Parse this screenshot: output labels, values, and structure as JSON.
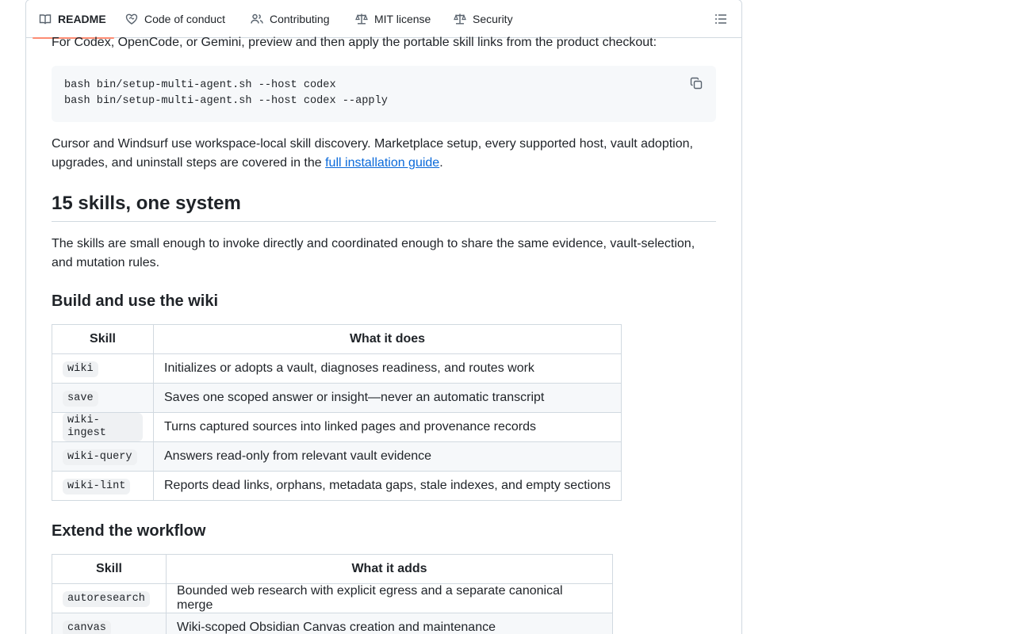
{
  "tabs": [
    {
      "label": "README",
      "icon": "book-icon",
      "active": true
    },
    {
      "label": "Code of conduct",
      "icon": "heart-handshake-icon"
    },
    {
      "label": "Contributing",
      "icon": "people-icon"
    },
    {
      "label": "MIT license",
      "icon": "scale-icon"
    },
    {
      "label": "Security",
      "icon": "scale-icon"
    }
  ],
  "accent_color": "#fd8c73",
  "link_color": "#0969da",
  "intro": "For Codex, OpenCode, or Gemini, preview and then apply the portable skill links from the product checkout:",
  "code_lines": [
    "bash bin/setup-multi-agent.sh --host codex",
    "bash bin/setup-multi-agent.sh --host codex --apply"
  ],
  "install_para": {
    "before": "Cursor and Windsurf use workspace-local skill discovery. Marketplace setup, every supported host, vault adoption, upgrades, and uninstall steps are covered in the ",
    "link": "full installation guide",
    "after": "."
  },
  "section_heading": "15 skills, one system",
  "section_para": "The skills are small enough to invoke directly and coordinated enough to share the same evidence, vault-selection, and mutation rules.",
  "build_heading": "Build and use the wiki",
  "build_table": {
    "headers": [
      "Skill",
      "What it does"
    ],
    "rows": [
      [
        "wiki",
        "Initializes or adopts a vault, diagnoses readiness, and routes work"
      ],
      [
        "save",
        "Saves one scoped answer or insight—never an automatic transcript"
      ],
      [
        "wiki-ingest",
        "Turns captured sources into linked pages and provenance records"
      ],
      [
        "wiki-query",
        "Answers read-only from relevant vault evidence"
      ],
      [
        "wiki-lint",
        "Reports dead links, orphans, metadata gaps, stale indexes, and empty sections"
      ]
    ]
  },
  "extend_heading": "Extend the workflow",
  "extend_table": {
    "headers": [
      "Skill",
      "What it adds"
    ],
    "rows": [
      [
        "autoresearch",
        "Bounded web research with explicit egress and a separate canonical merge"
      ],
      [
        "canvas",
        "Wiki-scoped Obsidian Canvas creation and maintenance"
      ]
    ]
  }
}
